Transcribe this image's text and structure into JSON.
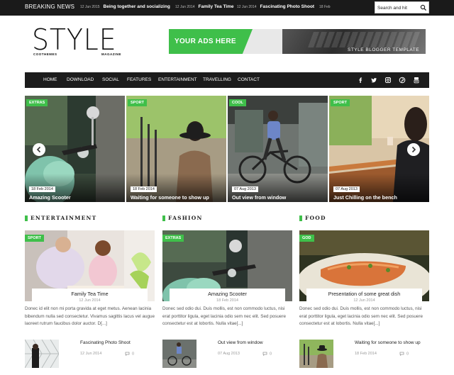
{
  "topbar": {
    "label": "Breaking News",
    "ticker": [
      {
        "date": "12 Jun 2015",
        "title": "Being together and socializing"
      },
      {
        "date": "12 Jun 2014",
        "title": "Family Tea Time"
      },
      {
        "date": "12 Jun 2014",
        "title": "Fascinating Photo Shoot"
      },
      {
        "date": "18 Feb",
        "title": ""
      }
    ],
    "search_placeholder": "Search and hit"
  },
  "logo": {
    "main": "STYLE",
    "left_sub": "COOTHEMES",
    "right_sub": "MAGAZINE"
  },
  "ad": {
    "text": "YOUR ADS HERE",
    "caption": "STYLE BLOGGER TEMPLATE"
  },
  "nav": {
    "items": [
      "Home",
      "Download",
      "Social",
      "Features",
      "Entertainment",
      "Travelling",
      "Contact"
    ],
    "social_icons": [
      "facebook-icon",
      "twitter-icon",
      "instagram-icon",
      "pinterest-icon",
      "youtube-icon"
    ]
  },
  "slider": {
    "slides": [
      {
        "category": "Extras",
        "date": "18 Feb 2014",
        "title": "Amazing Scooter"
      },
      {
        "category": "Sport",
        "date": "18 Feb 2014",
        "title": "Waiting for someone to show up"
      },
      {
        "category": "Cool",
        "date": "07 Aug 2013",
        "title": "Out view from window"
      },
      {
        "category": "Sport",
        "date": "07 Aug 2013",
        "title": "Just Chilling on the bench"
      }
    ]
  },
  "columns": [
    {
      "heading": "Entertainment",
      "category": "Sport",
      "title": "Family Tea Time",
      "date": "12 Jun 2014",
      "excerpt": "Donec id elit non mi porta gravida at eget metus. Aenean lacinia bibendum nulla sed consectetur. Vivamus sagittis lacus vel augue laoreet rutrum faucibus dolor auctor. D[...]",
      "mini": {
        "title": "Fascinating Photo Shoot",
        "date": "12 Jun 2014",
        "comments": "0"
      }
    },
    {
      "heading": "Fashion",
      "category": "Extras",
      "title": "Amazing Scooter",
      "date": "18 Feb 2014",
      "excerpt": "Donec sed odio dui. Duis mollis, est non commodo luctus, nisi erat porttitor ligula, eget lacinia odio sem nec elit. Sed posuere consectetur est at lobortis. Nulla vitae[...]",
      "mini": {
        "title": "Out view from window",
        "date": "07 Aug 2013",
        "comments": "0"
      }
    },
    {
      "heading": "Food",
      "category": "God",
      "title": "Presentation of some great dish",
      "date": "12 Jun 2014",
      "excerpt": "Donec sed odio dui. Duis mollis, est non commodo luctus, nisi erat porttitor ligula, eget lacinia odio sem nec elit. Sed posuere consectetur est at lobortis. Nulla vitae[...]",
      "mini": {
        "title": "Waiting for someone to show up",
        "date": "18 Feb 2014",
        "comments": "0"
      }
    }
  ],
  "colors": {
    "accent": "#3fbf4a",
    "dark": "#1c1c1c"
  }
}
